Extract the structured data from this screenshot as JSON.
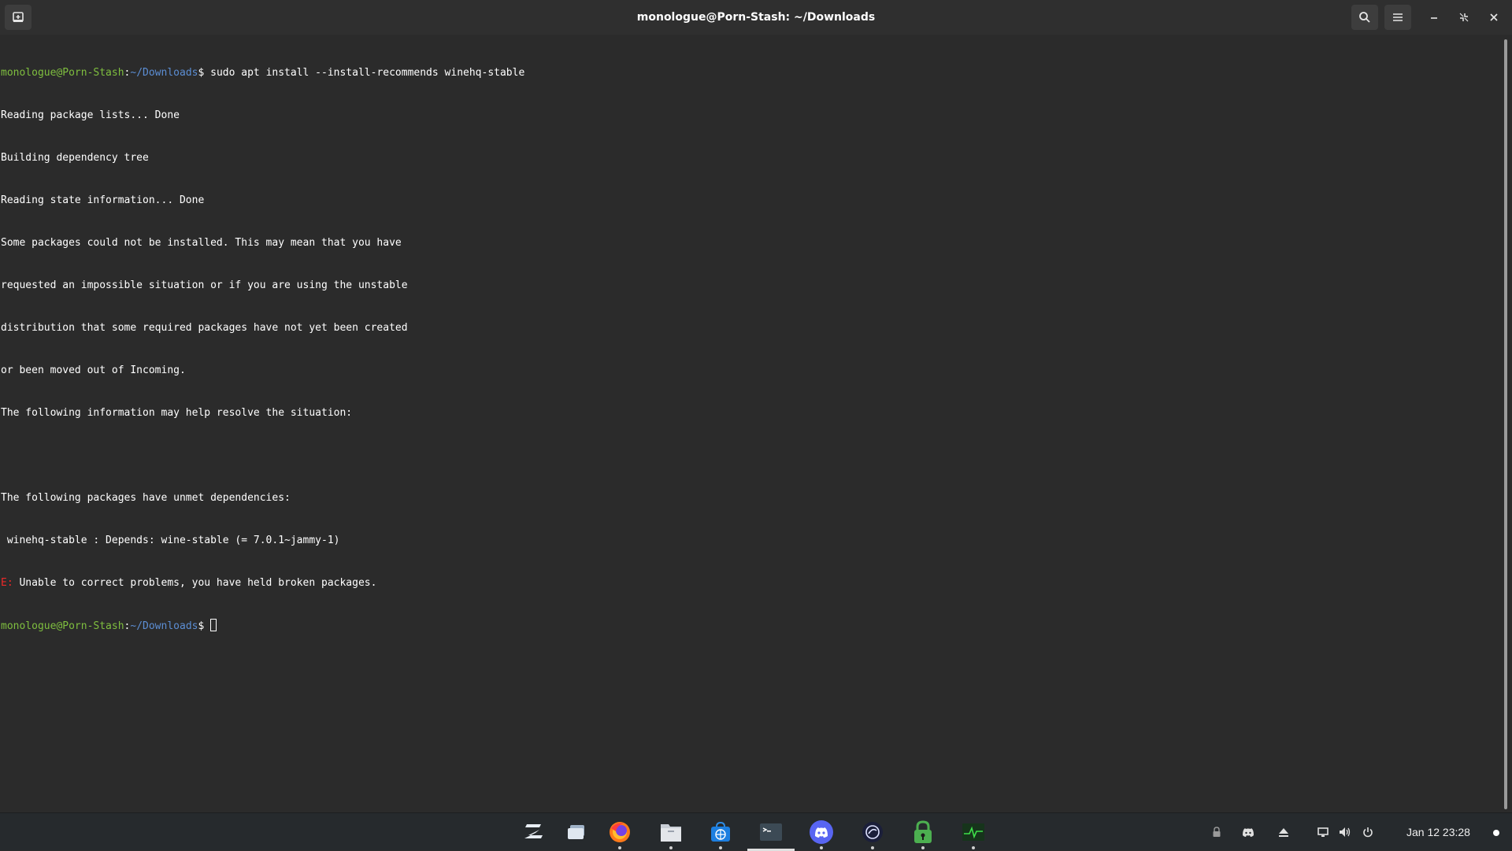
{
  "window": {
    "title": "monologue@Porn-Stash: ~/Downloads"
  },
  "icons": {
    "new_tab": "new-tab-icon",
    "search": "search-icon",
    "menu": "hamburger-menu-icon",
    "minimize": "minimize-icon",
    "maximize": "restore-icon",
    "close": "close-icon"
  },
  "terminal": {
    "prompt_user": "monologue@Porn-Stash",
    "prompt_sep": ":",
    "prompt_path": "~/Downloads",
    "prompt_dollar": "$",
    "command": " sudo apt install --install-recommends winehq-stable",
    "output": [
      "Reading package lists... Done",
      "Building dependency tree",
      "Reading state information... Done",
      "Some packages could not be installed. This may mean that you have",
      "requested an impossible situation or if you are using the unstable",
      "distribution that some required packages have not yet been created",
      "or been moved out of Incoming.",
      "The following information may help resolve the situation:",
      "",
      "The following packages have unmet dependencies:",
      " winehq-stable : Depends: wine-stable (= 7.0.1~jammy-1)"
    ],
    "error_prefix": "E:",
    "error_message": " Unable to correct problems, you have held broken packages.",
    "colors": {
      "user": "#7fbf3f",
      "path": "#5c8ed4",
      "error": "#ef2929",
      "background": "#2b2b2b"
    }
  },
  "taskbar": {
    "apps": [
      {
        "name": "zorin-menu-icon"
      },
      {
        "name": "workspaces-icon"
      },
      {
        "name": "firefox-icon"
      },
      {
        "name": "files-icon"
      },
      {
        "name": "software-store-icon"
      },
      {
        "name": "terminal-icon"
      },
      {
        "name": "discord-icon"
      },
      {
        "name": "app-icon"
      },
      {
        "name": "vpn-lock-icon"
      },
      {
        "name": "system-monitor-icon"
      }
    ],
    "tray": [
      "lock-icon",
      "discord-tray-icon",
      "eject-icon",
      "display-icon",
      "volume-icon",
      "power-icon"
    ],
    "clock": "Jan 12  23:28"
  }
}
